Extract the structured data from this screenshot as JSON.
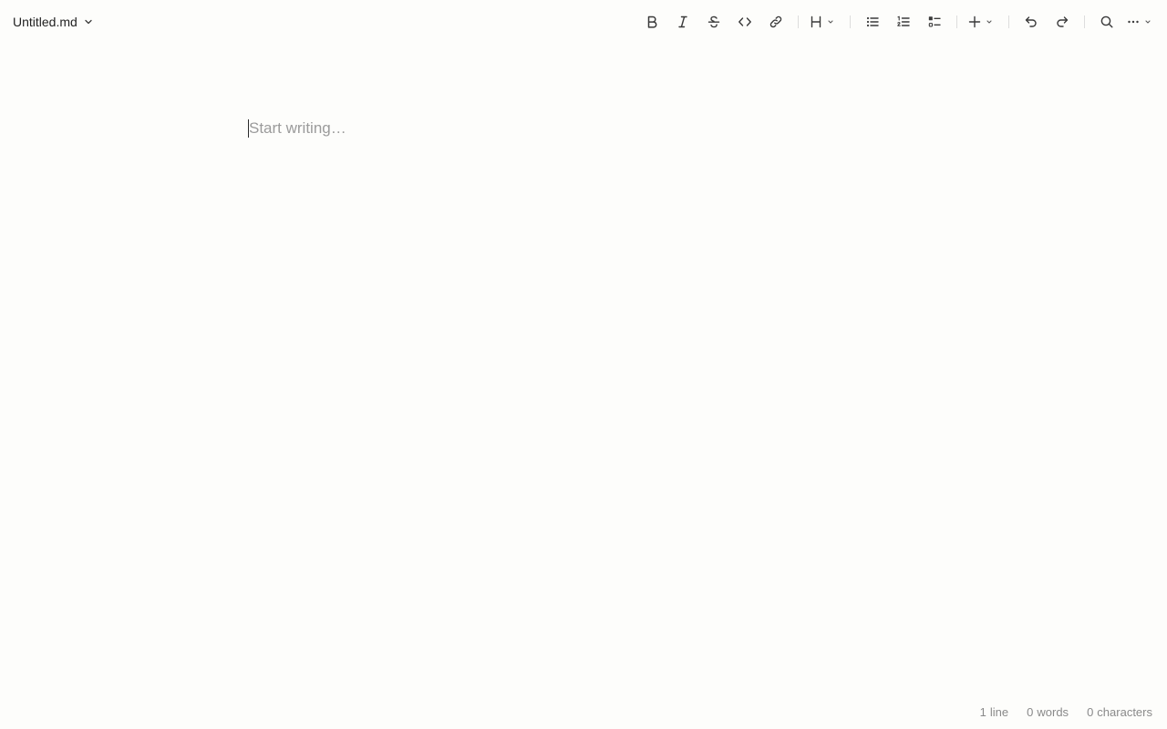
{
  "file": {
    "name": "Untitled.md",
    "menu_icon": "chevron-down-icon"
  },
  "toolbar": {
    "items": [
      {
        "name": "bold",
        "icon": "bold-icon"
      },
      {
        "name": "italic",
        "icon": "italic-icon"
      },
      {
        "name": "strikethrough",
        "icon": "strikethrough-icon"
      },
      {
        "name": "code",
        "icon": "code-icon"
      },
      {
        "name": "link",
        "icon": "link-icon"
      },
      {
        "name": "heading",
        "icon": "heading-icon"
      },
      {
        "name": "bullet-list",
        "icon": "bullet-list-icon"
      },
      {
        "name": "numbered-list",
        "icon": "numbered-list-icon"
      },
      {
        "name": "task-list",
        "icon": "task-list-icon"
      },
      {
        "name": "insert",
        "icon": "plus-icon"
      },
      {
        "name": "undo",
        "icon": "undo-icon"
      },
      {
        "name": "redo",
        "icon": "redo-icon"
      },
      {
        "name": "search",
        "icon": "search-icon"
      },
      {
        "name": "more",
        "icon": "more-icon"
      }
    ]
  },
  "editor": {
    "placeholder": "Start writing…",
    "value": ""
  },
  "status": {
    "lines_value": "1",
    "lines_label": "line",
    "words_value": "0",
    "words_label": "words",
    "chars_value": "0",
    "chars_label": "characters"
  },
  "colors": {
    "background": "#fdfdfb",
    "icon": "#3a3a3a",
    "placeholder": "#9b9b9b",
    "status_text": "#8a8a8a",
    "separator": "#dddddd"
  }
}
